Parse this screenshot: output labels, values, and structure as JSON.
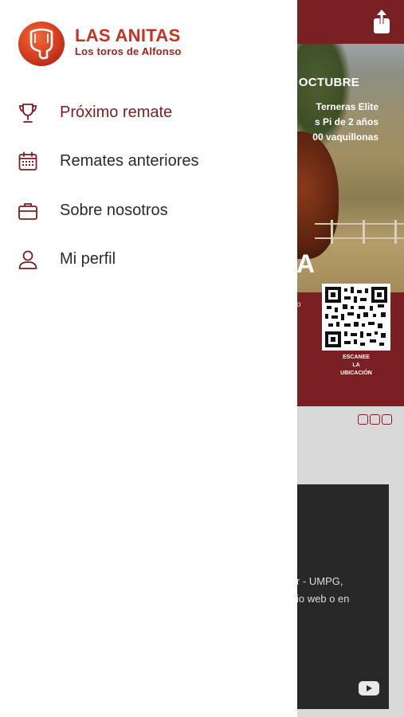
{
  "brand": {
    "name": "LAS ANITAS",
    "tagline": "Los toros de Alfonso"
  },
  "menu": {
    "items": [
      {
        "label": "Próximo remate",
        "icon": "trophy-icon",
        "active": true
      },
      {
        "label": "Remates anteriores",
        "icon": "calendar-icon",
        "active": false
      },
      {
        "label": "Sobre nosotros",
        "icon": "briefcase-icon",
        "active": false
      },
      {
        "label": "Mi perfil",
        "icon": "user-icon",
        "active": false
      }
    ]
  },
  "background": {
    "banner": {
      "date_fragment": "E OCTUBRE",
      "line1": "Terneras Elite",
      "line2": "s Pi de 2 años",
      "line3": "00 vaquillonas",
      "big_text": "A"
    },
    "small_fragment": "o",
    "qr_caption": [
      "ESCANEE",
      "LA",
      "UBICACIÓN"
    ],
    "video_text": [
      "r - UMPG,",
      "io web o en"
    ],
    "share_icon": "share-icon",
    "youtube_icon": "youtube-icon",
    "social_icons": [
      "twitter-icon",
      "facebook-icon",
      "instagram-icon"
    ]
  },
  "colors": {
    "brand_dark_red": "#7a1f22",
    "brand_red": "#c8321e",
    "drawer_bg": "#ffffff"
  }
}
